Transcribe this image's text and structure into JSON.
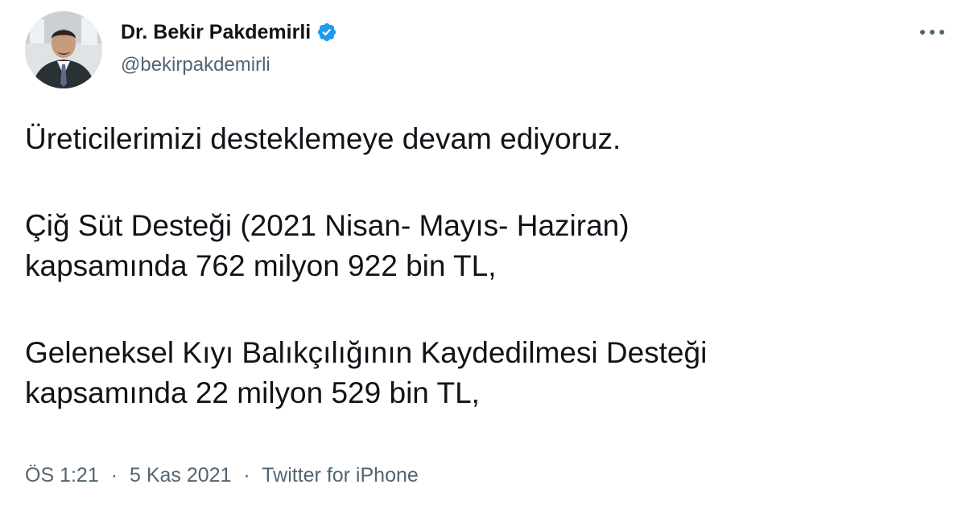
{
  "author": {
    "name": "Dr. Bekir Pakdemirli",
    "handle": "@bekirpakdemirli",
    "verified_icon": "verified-badge-icon"
  },
  "more_icon": "more-horizontal-icon",
  "tweet": {
    "lines": [
      "Üreticilerimizi desteklemeye devam ediyoruz.",
      "Çiğ Süt Desteği (2021 Nisan- Mayıs- Haziran)",
      "kapsamında 762 milyon 922 bin TL,",
      "Geleneksel Kıyı Balıkçılığının Kaydedilmesi Desteği",
      "kapsamında 22 milyon 529 bin TL,"
    ]
  },
  "meta": {
    "time": "ÖS 1:21",
    "date": "5 Kas 2021",
    "source": "Twitter for iPhone",
    "separator": "·"
  },
  "colors": {
    "text": "#0f1419",
    "secondary": "#536471",
    "verified": "#1d9bf0"
  }
}
